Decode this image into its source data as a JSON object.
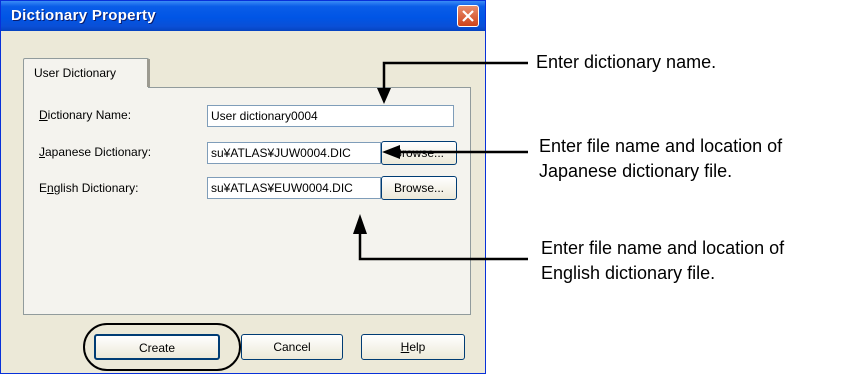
{
  "window": {
    "title": "Dictionary Property"
  },
  "tabs": [
    {
      "label": "User Dictionary"
    }
  ],
  "form": {
    "dictionary_name": {
      "label_u": "D",
      "label_rest": "ictionary Name:",
      "value": "User dictionary0004"
    },
    "japanese_dictionary": {
      "label_u": "J",
      "label_rest": "apanese Dictionary:",
      "value": "su¥ATLAS¥JUW0004.DIC"
    },
    "english_dictionary": {
      "label_pre": "E",
      "label_u": "n",
      "label_rest": "glish Dictionary:",
      "value": "su¥ATLAS¥EUW0004.DIC"
    },
    "browse_label": "Browse..."
  },
  "buttons": {
    "create": "Create",
    "cancel": "Cancel",
    "help_u": "H",
    "help_rest": "elp"
  },
  "annotations": {
    "name": "Enter dictionary name.",
    "japanese_line1": "Enter file name and location of",
    "japanese_line2": "Japanese dictionary file.",
    "english_line1": "Enter file name and location of",
    "english_line2": "English dictionary file."
  },
  "colors": {
    "titlebar": "#0055e5",
    "dialog_bg": "#ece9d8",
    "close_button": "#d0431a"
  }
}
